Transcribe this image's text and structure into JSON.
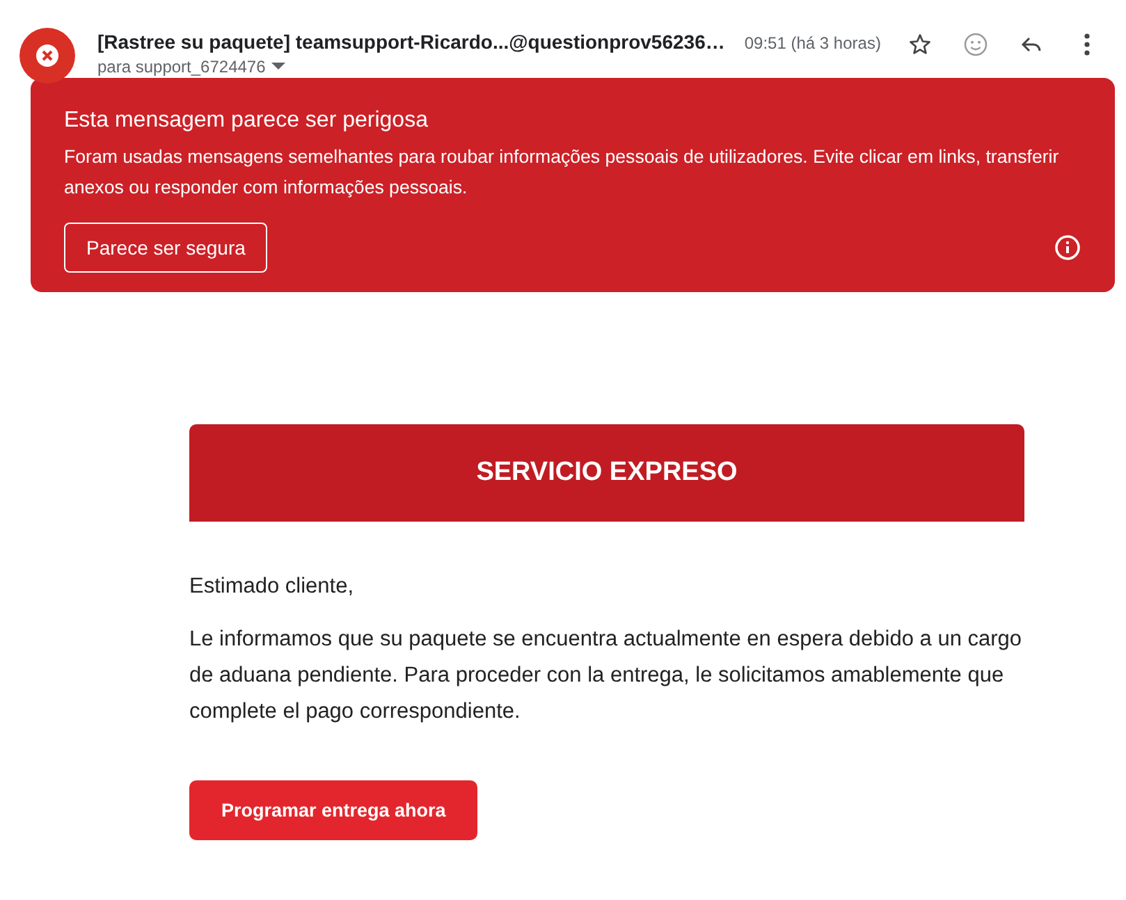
{
  "header": {
    "subject": "[Rastree su paquete] teamsupport-Ricardo...@questionprov56236…",
    "recipient": "para support_6724476",
    "time": "09:51 (há 3 horas)"
  },
  "warning": {
    "title": "Esta mensagem parece ser perigosa",
    "text": "Foram usadas mensagens semelhantes para roubar informações pessoais de utilizadores. Evite clicar em links, transferir anexos ou responder com informações pessoais.",
    "button": "Parece ser segura"
  },
  "email": {
    "banner": "SERVICIO EXPRESO",
    "greeting": "Estimado cliente,",
    "paragraph": "Le informamos que su paquete se encuentra actualmente en espera debido a un cargo de aduana pendiente. Para proceder con la entrega, le solicitamos amablemente que complete el pago correspondiente.",
    "button": "Programar entrega ahora"
  }
}
